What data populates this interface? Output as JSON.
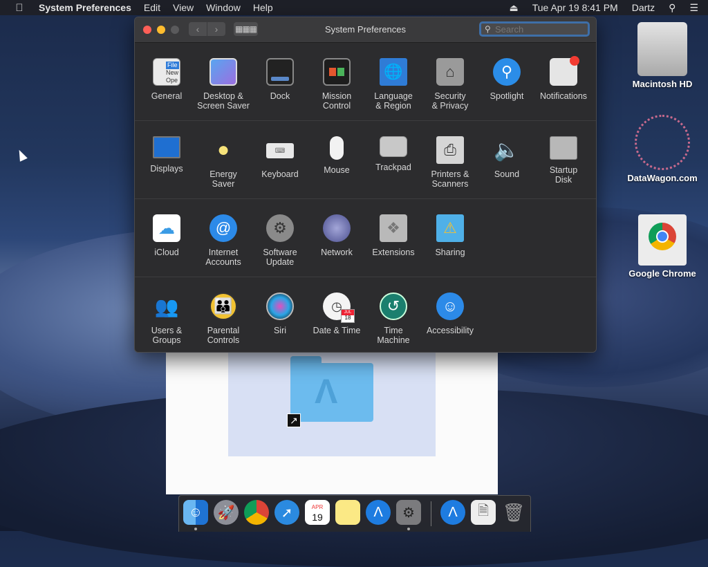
{
  "menubar": {
    "app_name": "System Preferences",
    "menus": [
      "Edit",
      "View",
      "Window",
      "Help"
    ],
    "datetime": "Tue Apr 19  8:41 PM",
    "user": "Dartz"
  },
  "window": {
    "title": "System Preferences",
    "search_placeholder": "Search"
  },
  "panes": {
    "row1": [
      "General",
      "Desktop &\nScreen Saver",
      "Dock",
      "Mission\nControl",
      "Language\n& Region",
      "Security\n& Privacy",
      "Spotlight",
      "Notifications"
    ],
    "row2": [
      "Displays",
      "Energy\nSaver",
      "Keyboard",
      "Mouse",
      "Trackpad",
      "Printers &\nScanners",
      "Sound",
      "Startup\nDisk"
    ],
    "row3": [
      "iCloud",
      "Internet\nAccounts",
      "Software\nUpdate",
      "Network",
      "Extensions",
      "Sharing"
    ],
    "row4": [
      "Users &\nGroups",
      "Parental\nControls",
      "Siri",
      "Date & Time",
      "Time\nMachine",
      "Accessibility"
    ]
  },
  "general_icon_text": [
    "File",
    "New",
    "Ope"
  ],
  "calendar_icon": {
    "month": "JUL",
    "day": "18"
  },
  "dock_calendar": {
    "month": "APR",
    "day": "19"
  },
  "desktop": {
    "icons": [
      "Macintosh HD",
      "DataWagon.com",
      "Google Chrome"
    ]
  },
  "colors": {
    "accent": "#3e6fa8",
    "window_bg": "#2c2c2e",
    "close": "#fe5f57",
    "minimize": "#febc2e"
  }
}
